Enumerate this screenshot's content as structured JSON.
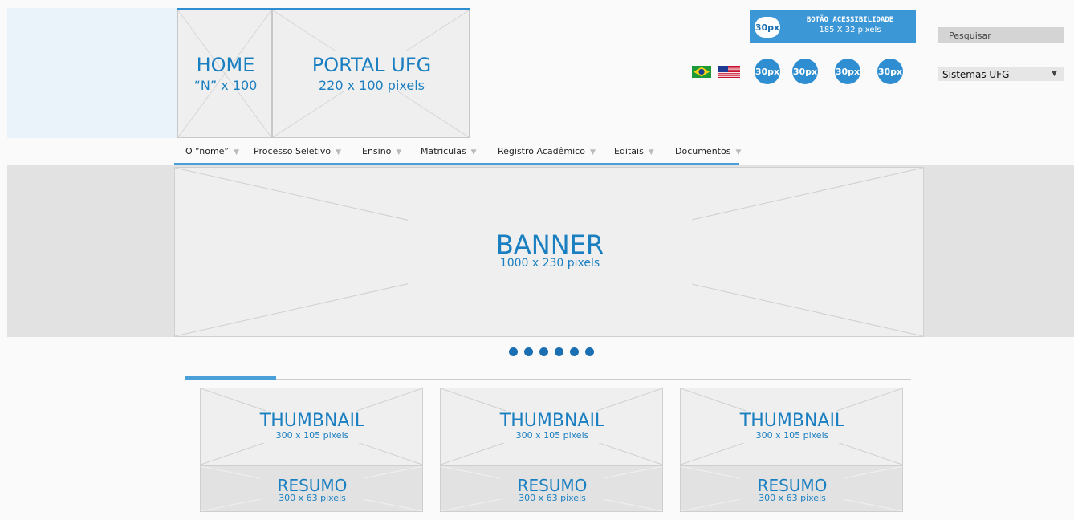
{
  "header": {
    "home": {
      "title": "HOME",
      "subtitle": "“N” x 100"
    },
    "portal": {
      "title": "PORTAL UFG",
      "subtitle": "220 x 100 pixels"
    },
    "accessibility": {
      "badge": "30px",
      "title": "BOTÃO ACESSIBILIDADE",
      "subtitle": "185 X 32 pixels"
    },
    "flags": [
      "brazil-flag-icon",
      "usa-flag-icon"
    ],
    "social_circles": [
      "30px",
      "30px",
      "30px",
      "30px"
    ]
  },
  "search": {
    "placeholder": "Pesquisar"
  },
  "systems_select": {
    "value": "Sistemas UFG",
    "arrow": "▼"
  },
  "nav": {
    "items": [
      {
        "label": "O “nome”"
      },
      {
        "label": "Processo Seletivo"
      },
      {
        "label": "Ensino"
      },
      {
        "label": "Matriculas"
      },
      {
        "label": "Registro Acadêmico"
      },
      {
        "label": "Editais"
      },
      {
        "label": "Documentos"
      }
    ],
    "caret": "▼"
  },
  "banner": {
    "title": "BANNER",
    "subtitle": "1000 x 230 pixels",
    "dots": 6
  },
  "cards": [
    {
      "thumb_title": "THUMBNAIL",
      "thumb_sub": "300 x 105 pixels",
      "summary_title": "RESUMO",
      "summary_sub": "300 x 63 pixels"
    },
    {
      "thumb_title": "THUMBNAIL",
      "thumb_sub": "300 x 105 pixels",
      "summary_title": "RESUMO",
      "summary_sub": "300 x 63 pixels"
    },
    {
      "thumb_title": "THUMBNAIL",
      "thumb_sub": "300 x 105 pixels",
      "summary_title": "RESUMO",
      "summary_sub": "300 x 63 pixels"
    }
  ],
  "colors": {
    "accent": "#1a7fc1",
    "accessibility_bg": "#3c97d6",
    "placeholder_bg": "#efefef"
  }
}
